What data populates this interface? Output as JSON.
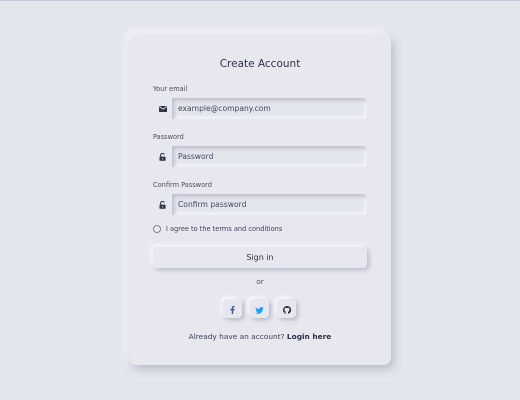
{
  "form": {
    "title": "Create Account",
    "email": {
      "label": "Your email",
      "placeholder": "example@company.com",
      "icon": "envelope-icon"
    },
    "password": {
      "label": "Password",
      "placeholder": "Password",
      "icon": "lock-icon"
    },
    "confirm_password": {
      "label": "Confirm Password",
      "placeholder": "Confirm password",
      "icon": "lock-icon"
    },
    "terms": {
      "label": "I agree to the terms and conditions",
      "checked": false
    },
    "submit_label": "Sign in",
    "divider_text": "or",
    "social_buttons": [
      {
        "icon": "facebook-icon",
        "color": "#3b5998"
      },
      {
        "icon": "twitter-icon",
        "color": "#1da1f2"
      },
      {
        "icon": "github-icon",
        "color": "#24292e"
      }
    ],
    "footer_text": "Already have an account?",
    "footer_link": "Login here"
  }
}
